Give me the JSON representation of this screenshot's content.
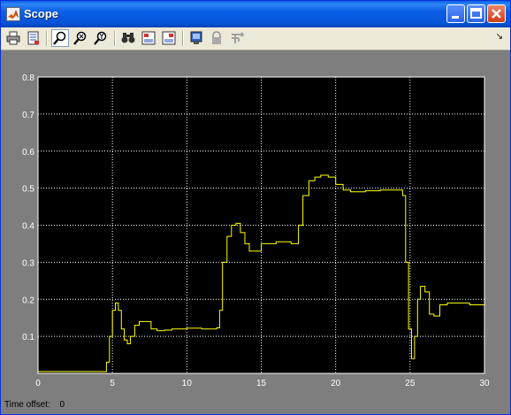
{
  "window": {
    "title": "Scope"
  },
  "toolbar": {
    "icons": [
      "print-icon",
      "parameters-icon",
      "zoom-icon",
      "zoom-x-icon",
      "zoom-y-icon",
      "autoscale-icon",
      "save-axes-icon",
      "restore-axes-icon",
      "floating-scope-icon",
      "lock-axes-icon",
      "signal-selector-icon"
    ]
  },
  "status": {
    "time_offset_label": "Time offset:",
    "time_offset_value": "0"
  },
  "colors": {
    "axes_bg": "#000000",
    "figure_bg": "#7e7e7e",
    "trace": "#ffff00",
    "grid": "#ffffff",
    "tick_text": "#ffffff"
  },
  "chart_data": {
    "type": "line",
    "xlim": [
      0,
      30
    ],
    "ylim": [
      0,
      0.8
    ],
    "xticks": [
      "0",
      "5",
      "10",
      "15",
      "20",
      "25",
      "30"
    ],
    "yticks": [
      "0.1",
      "0.2",
      "0.3",
      "0.4",
      "0.5",
      "0.6",
      "0.7",
      "0.8"
    ],
    "grid": true,
    "series": [
      {
        "x": [
          0,
          4.5,
          4.6,
          4.8,
          5.0,
          5.2,
          5.4,
          5.6,
          5.8,
          6.0,
          6.2,
          6.5,
          6.8,
          7.2,
          7.6,
          8.0,
          8.5,
          9.0,
          10.0,
          11.0,
          12.0,
          12.2,
          12.4,
          12.7,
          13.0,
          13.3,
          13.6,
          13.9,
          14.2,
          14.6,
          15.0,
          16.0,
          17.0,
          17.5,
          17.8,
          18.2,
          18.6,
          19.0,
          19.5,
          20.0,
          20.5,
          21.0,
          22.0,
          23.0,
          24.0,
          24.5,
          24.7,
          24.9,
          25.1,
          25.3,
          25.5,
          25.7,
          26.0,
          26.3,
          26.6,
          27.0,
          27.5,
          28.0,
          29.0,
          30.0
        ],
        "y": [
          0.005,
          0.005,
          0.03,
          0.1,
          0.17,
          0.19,
          0.17,
          0.12,
          0.09,
          0.08,
          0.1,
          0.13,
          0.14,
          0.14,
          0.12,
          0.115,
          0.117,
          0.12,
          0.122,
          0.12,
          0.123,
          0.17,
          0.3,
          0.37,
          0.4,
          0.405,
          0.38,
          0.35,
          0.33,
          0.33,
          0.35,
          0.355,
          0.35,
          0.4,
          0.48,
          0.52,
          0.53,
          0.535,
          0.53,
          0.51,
          0.495,
          0.49,
          0.493,
          0.495,
          0.495,
          0.48,
          0.3,
          0.12,
          0.04,
          0.1,
          0.2,
          0.235,
          0.22,
          0.16,
          0.155,
          0.185,
          0.19,
          0.19,
          0.185,
          0.18
        ]
      }
    ]
  }
}
